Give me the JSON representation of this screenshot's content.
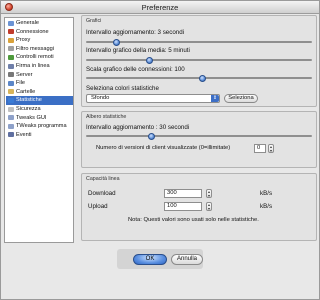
{
  "window": {
    "title": "Preferenze"
  },
  "sidebar": {
    "items": [
      {
        "label": "Generale",
        "icon": "general-icon",
        "color": "#6b93d4"
      },
      {
        "label": "Connessione",
        "icon": "connection-icon",
        "color": "#c03b2b"
      },
      {
        "label": "Proxy",
        "icon": "proxy-icon",
        "color": "#d9a23a"
      },
      {
        "label": "Filtro messaggi",
        "icon": "message-filter-icon",
        "color": "#a0a0a0"
      },
      {
        "label": "Controlli remoti",
        "icon": "remote-control-icon",
        "color": "#4e9a3c"
      },
      {
        "label": "Firma in linea",
        "icon": "online-signature-icon",
        "color": "#6f7fa9"
      },
      {
        "label": "Server",
        "icon": "server-icon",
        "color": "#777777"
      },
      {
        "label": "File",
        "icon": "file-icon",
        "color": "#5b86c8"
      },
      {
        "label": "Cartelle",
        "icon": "folder-icon",
        "color": "#d7b45a"
      },
      {
        "label": "Statistiche",
        "icon": "statistics-icon",
        "color": "#3a7bd5"
      },
      {
        "label": "Sicurezza",
        "icon": "security-icon",
        "color": "#c0c0c0"
      },
      {
        "label": "Tweaks GUI",
        "icon": "tweaks-gui-icon",
        "color": "#8ea1c9"
      },
      {
        "label": "TWeaks programma",
        "icon": "tweaks-program-icon",
        "color": "#8ea1c9"
      },
      {
        "label": "Eventi",
        "icon": "events-icon",
        "color": "#5f6fa0"
      }
    ],
    "selected": "Statistiche"
  },
  "grafici": {
    "group_title": "Grafici",
    "update_interval_label": "Intervallo aggiornamento: 3 secondi",
    "update_interval_value": 0.12,
    "average_interval_label": "Intervallo grafico della media: 5 minuti",
    "average_interval_value": 0.27,
    "scale_label": "Scala grafico delle connessioni: 100",
    "scale_value": 0.51,
    "color_select_label": "Seleziona colori statistiche",
    "color_select_value": "Sfondo",
    "select_button": "Seleziona"
  },
  "albero": {
    "group_title": "Albero statistiche",
    "update_interval_label": "Intervallo aggiornamento : 30 secondi",
    "update_interval_value": 0.28,
    "client_versions_label": "Numero di versioni di client visualizzate (0=illimitate)",
    "client_versions_value": "0"
  },
  "capacita": {
    "group_title": "Capacità linea",
    "download_label": "Download",
    "download_value": "300",
    "download_unit": "kB/s",
    "upload_label": "Upload",
    "upload_value": "100",
    "upload_unit": "kB/s",
    "note": "Nota: Questi valori sono usati solo nelle statistiche."
  },
  "buttons": {
    "ok": "OK",
    "cancel": "Annulla"
  },
  "colors": {
    "selection": "#3b6fc5",
    "accent": "#5a8fe0"
  }
}
